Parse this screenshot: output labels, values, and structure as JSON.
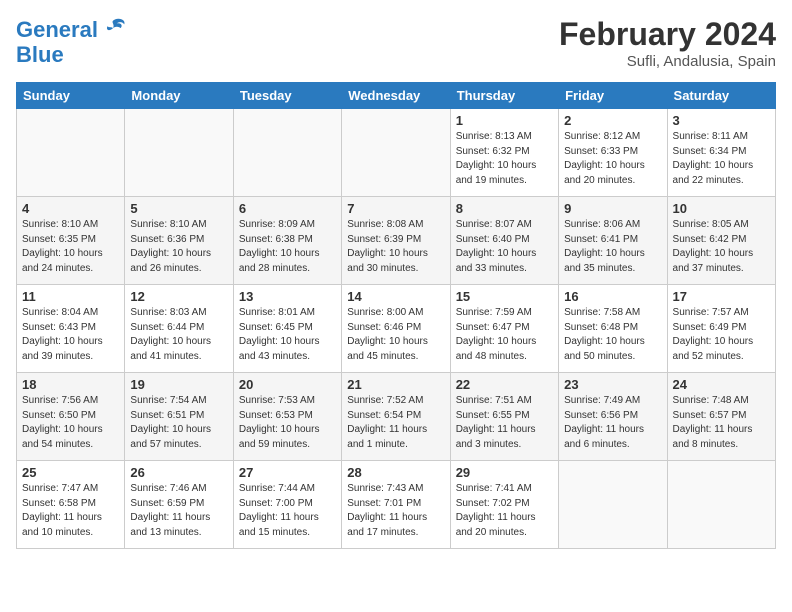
{
  "header": {
    "logo_line1": "General",
    "logo_line2": "Blue",
    "month_title": "February 2024",
    "location": "Sufli, Andalusia, Spain"
  },
  "weekdays": [
    "Sunday",
    "Monday",
    "Tuesday",
    "Wednesday",
    "Thursday",
    "Friday",
    "Saturday"
  ],
  "weeks": [
    [
      {
        "day": "",
        "info": ""
      },
      {
        "day": "",
        "info": ""
      },
      {
        "day": "",
        "info": ""
      },
      {
        "day": "",
        "info": ""
      },
      {
        "day": "1",
        "info": "Sunrise: 8:13 AM\nSunset: 6:32 PM\nDaylight: 10 hours\nand 19 minutes."
      },
      {
        "day": "2",
        "info": "Sunrise: 8:12 AM\nSunset: 6:33 PM\nDaylight: 10 hours\nand 20 minutes."
      },
      {
        "day": "3",
        "info": "Sunrise: 8:11 AM\nSunset: 6:34 PM\nDaylight: 10 hours\nand 22 minutes."
      }
    ],
    [
      {
        "day": "4",
        "info": "Sunrise: 8:10 AM\nSunset: 6:35 PM\nDaylight: 10 hours\nand 24 minutes."
      },
      {
        "day": "5",
        "info": "Sunrise: 8:10 AM\nSunset: 6:36 PM\nDaylight: 10 hours\nand 26 minutes."
      },
      {
        "day": "6",
        "info": "Sunrise: 8:09 AM\nSunset: 6:38 PM\nDaylight: 10 hours\nand 28 minutes."
      },
      {
        "day": "7",
        "info": "Sunrise: 8:08 AM\nSunset: 6:39 PM\nDaylight: 10 hours\nand 30 minutes."
      },
      {
        "day": "8",
        "info": "Sunrise: 8:07 AM\nSunset: 6:40 PM\nDaylight: 10 hours\nand 33 minutes."
      },
      {
        "day": "9",
        "info": "Sunrise: 8:06 AM\nSunset: 6:41 PM\nDaylight: 10 hours\nand 35 minutes."
      },
      {
        "day": "10",
        "info": "Sunrise: 8:05 AM\nSunset: 6:42 PM\nDaylight: 10 hours\nand 37 minutes."
      }
    ],
    [
      {
        "day": "11",
        "info": "Sunrise: 8:04 AM\nSunset: 6:43 PM\nDaylight: 10 hours\nand 39 minutes."
      },
      {
        "day": "12",
        "info": "Sunrise: 8:03 AM\nSunset: 6:44 PM\nDaylight: 10 hours\nand 41 minutes."
      },
      {
        "day": "13",
        "info": "Sunrise: 8:01 AM\nSunset: 6:45 PM\nDaylight: 10 hours\nand 43 minutes."
      },
      {
        "day": "14",
        "info": "Sunrise: 8:00 AM\nSunset: 6:46 PM\nDaylight: 10 hours\nand 45 minutes."
      },
      {
        "day": "15",
        "info": "Sunrise: 7:59 AM\nSunset: 6:47 PM\nDaylight: 10 hours\nand 48 minutes."
      },
      {
        "day": "16",
        "info": "Sunrise: 7:58 AM\nSunset: 6:48 PM\nDaylight: 10 hours\nand 50 minutes."
      },
      {
        "day": "17",
        "info": "Sunrise: 7:57 AM\nSunset: 6:49 PM\nDaylight: 10 hours\nand 52 minutes."
      }
    ],
    [
      {
        "day": "18",
        "info": "Sunrise: 7:56 AM\nSunset: 6:50 PM\nDaylight: 10 hours\nand 54 minutes."
      },
      {
        "day": "19",
        "info": "Sunrise: 7:54 AM\nSunset: 6:51 PM\nDaylight: 10 hours\nand 57 minutes."
      },
      {
        "day": "20",
        "info": "Sunrise: 7:53 AM\nSunset: 6:53 PM\nDaylight: 10 hours\nand 59 minutes."
      },
      {
        "day": "21",
        "info": "Sunrise: 7:52 AM\nSunset: 6:54 PM\nDaylight: 11 hours\nand 1 minute."
      },
      {
        "day": "22",
        "info": "Sunrise: 7:51 AM\nSunset: 6:55 PM\nDaylight: 11 hours\nand 3 minutes."
      },
      {
        "day": "23",
        "info": "Sunrise: 7:49 AM\nSunset: 6:56 PM\nDaylight: 11 hours\nand 6 minutes."
      },
      {
        "day": "24",
        "info": "Sunrise: 7:48 AM\nSunset: 6:57 PM\nDaylight: 11 hours\nand 8 minutes."
      }
    ],
    [
      {
        "day": "25",
        "info": "Sunrise: 7:47 AM\nSunset: 6:58 PM\nDaylight: 11 hours\nand 10 minutes."
      },
      {
        "day": "26",
        "info": "Sunrise: 7:46 AM\nSunset: 6:59 PM\nDaylight: 11 hours\nand 13 minutes."
      },
      {
        "day": "27",
        "info": "Sunrise: 7:44 AM\nSunset: 7:00 PM\nDaylight: 11 hours\nand 15 minutes."
      },
      {
        "day": "28",
        "info": "Sunrise: 7:43 AM\nSunset: 7:01 PM\nDaylight: 11 hours\nand 17 minutes."
      },
      {
        "day": "29",
        "info": "Sunrise: 7:41 AM\nSunset: 7:02 PM\nDaylight: 11 hours\nand 20 minutes."
      },
      {
        "day": "",
        "info": ""
      },
      {
        "day": "",
        "info": ""
      }
    ]
  ]
}
